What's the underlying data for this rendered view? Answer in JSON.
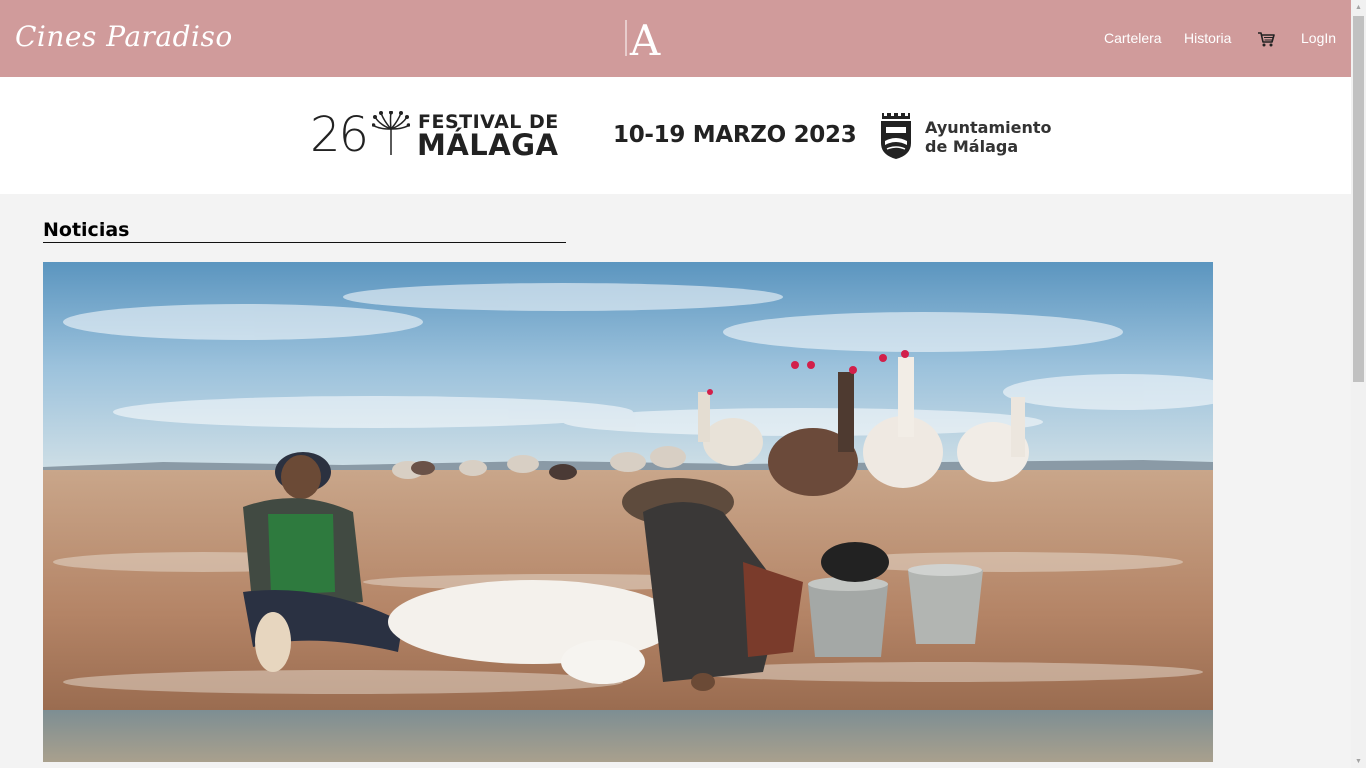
{
  "header": {
    "brand": "Cines Paradiso",
    "logo_letter": "A",
    "nav": [
      {
        "label": "Cartelera"
      },
      {
        "label": "Historia"
      },
      {
        "label": "LogIn"
      }
    ],
    "cart_icon": "cart-icon",
    "background_color": "#d09b9b"
  },
  "banner": {
    "edition": "26",
    "festival_line1": "FESTIVAL DE",
    "festival_line2": "MÁLAGA",
    "dates": "10-19 MARZO 2023",
    "sponsor_line1": "Ayuntamiento",
    "sponsor_line2": "de Málaga"
  },
  "main": {
    "section_title": "Noticias"
  }
}
